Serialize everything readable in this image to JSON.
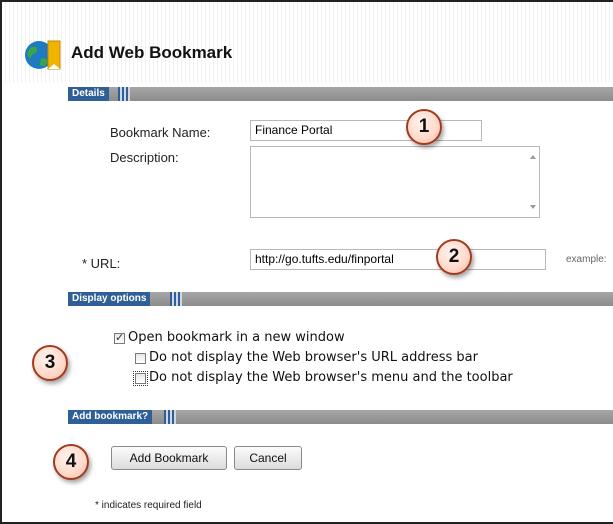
{
  "page": {
    "title": "Add Web Bookmark"
  },
  "sections": {
    "details": "Details",
    "display_options": "Display options",
    "add_bookmark": "Add bookmark?"
  },
  "form": {
    "bookmark_name_label": "Bookmark Name:",
    "bookmark_name_value": "Finance Portal",
    "description_label": "Description:",
    "description_value": "",
    "url_label": "* URL:",
    "url_value": "http://go.tufts.edu/finportal",
    "url_example": "example:"
  },
  "options": {
    "open_new_window": {
      "label": "Open bookmark in a new window",
      "checked": true
    },
    "hide_url_bar": {
      "label": "Do not display the Web browser's URL address bar",
      "checked": false
    },
    "hide_menu_toolbar": {
      "label": "Do not display the Web browser's menu and the toolbar",
      "checked": false
    }
  },
  "buttons": {
    "add": "Add Bookmark",
    "cancel": "Cancel"
  },
  "footer": {
    "required_note": "* indicates required field"
  },
  "callouts": [
    "1",
    "2",
    "3",
    "4"
  ],
  "icons": {
    "app_logo": "globe-bookmark-icon"
  },
  "colors": {
    "section_label_bg": "#2f5f97",
    "section_bar": "#9a9a9a",
    "callout_border": "#a23a1f",
    "callout_fill": "#ffd9c9"
  }
}
